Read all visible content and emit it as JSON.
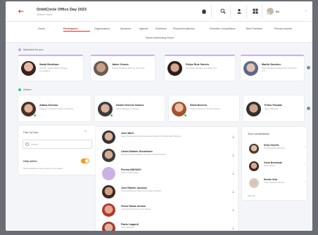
{
  "header": {
    "event_title": "OrbitCircle Office Day 2023",
    "event_subtitle": "Online event",
    "back_glyph": "⇠",
    "language": "EN",
    "icons": [
      "home-icon",
      "search-icon",
      "person-icon",
      "grid-icon"
    ]
  },
  "nav": {
    "row1": [
      "Home",
      "Participants",
      "Organizations",
      "Speakers",
      "Agenda",
      "Exhibitors",
      "Physical Auditorium",
      "Scientific Competitions",
      "Best Practices",
      "Plenary Awards"
    ],
    "row2": [
      "Speed Networking Room"
    ]
  },
  "suggested": {
    "title": "Matched for you",
    "people": [
      {
        "name": "Sarah Beckham",
        "role": "Director, Health Affairs Strategy Consultancy"
      },
      {
        "name": "Jaime Ornera",
        "role": "Partner Relations Director at Consul"
      },
      {
        "name": "Felipe Ruiz Garcés",
        "role": "Associate Manager at Logistic S.A."
      },
      {
        "name": "Martin Sanchez",
        "role": "Sales Manager at Research Interactive S.A."
      }
    ]
  },
  "online": {
    "title": "Online",
    "people": [
      {
        "name": "Aitana Serrano",
        "role": "Strategy Innovation Leader at Startup"
      },
      {
        "name": "Daniel Herrera Simons",
        "role": "Sales Manager at Startup"
      },
      {
        "name": "Silvia Borrero",
        "role": "Product Owner at Consul Startup"
      },
      {
        "name": "Primo Posada",
        "role": "Sales Manager"
      }
    ]
  },
  "filter": {
    "title": "Filter by Data",
    "search_placeholder": "Search",
    "toggle_title": "Only online",
    "toggle_desc": "Show available people to start a conversation",
    "toggle_on": true
  },
  "list": [
    {
      "name": "Jose Martí",
      "role": "Sales Development Representative (Spain & Portugal) Auth Manager"
    },
    {
      "name": "Carlos Barbier Doordnach",
      "role": "Director, Bonded Relation Services Auth Barcelona"
    },
    {
      "name": "Fiorina ABOUDO",
      "role": "Auth & Authorization"
    },
    {
      "name": "José Ramón Jacobus",
      "role": "Technical Director, Risk & Information Solution"
    },
    {
      "name": "Víctor Navas Acosta",
      "role": "Corporate Development at Startup"
    },
    {
      "name": "Pablo Llagardi",
      "role": "Sales Manager"
    }
  ],
  "connections": {
    "title": "Your connections",
    "people": [
      {
        "name": "Kelly Chevelle",
        "role": "Technical Sales Executive"
      },
      {
        "name": "Oscar Bermánda",
        "role": "Sales Director"
      },
      {
        "name": "Hernán Ortiz",
        "role": "Chief Operations Director"
      }
    ],
    "more": "View all"
  },
  "colors": {
    "accent": "#c0392b",
    "online": "#2ecc71",
    "toggle": "#f39c12",
    "link": "#7b8bb0"
  }
}
